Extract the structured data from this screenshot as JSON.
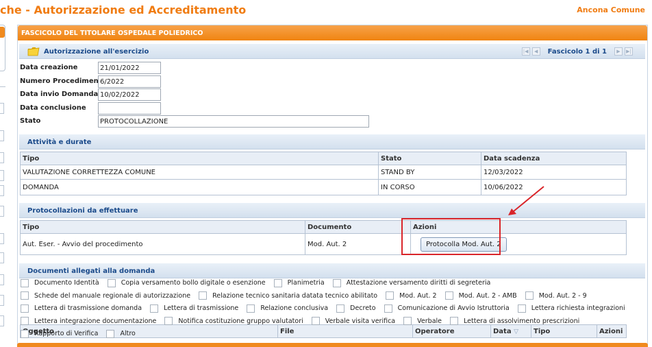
{
  "app": {
    "title": "che - Autorizzazione ed Accreditamento",
    "user": "Ancona Comune"
  },
  "panel": {
    "header": "FASCICOLO DEL TITOLARE OSPEDALE POLIEDRICO"
  },
  "authorization": {
    "title": "Autorizzazione all'esercizio",
    "pager_text": "Fascicolo 1 di 1",
    "fields": {
      "data_creazione": {
        "label": "Data creazione",
        "value": "21/01/2022"
      },
      "numero_procedimento": {
        "label": "Numero Procedimento",
        "value": "6/2022"
      },
      "data_invio_domanda": {
        "label": "Data invio Domanda",
        "value": "10/02/2022"
      },
      "data_conclusione": {
        "label": "Data conclusione",
        "value": ""
      },
      "stato": {
        "label": "Stato",
        "value": "PROTOCOLLAZIONE"
      }
    }
  },
  "activities": {
    "title": "Attività e durate",
    "columns": [
      "Tipo",
      "Stato",
      "Data scadenza"
    ],
    "rows": [
      [
        "VALUTAZIONE CORRETTEZZA COMUNE",
        "STAND BY",
        "12/03/2022"
      ],
      [
        "DOMANDA",
        "IN CORSO",
        "10/06/2022"
      ]
    ]
  },
  "protocols": {
    "title": "Protocollazioni da effettuare",
    "columns": [
      "Tipo",
      "Documento",
      "Azioni"
    ],
    "rows": [
      {
        "tipo": "Aut. Eser. - Avvio del procedimento",
        "documento": "Mod. Aut. 2",
        "action": "Protocolla Mod. Aut. 2"
      }
    ]
  },
  "documents": {
    "title": "Documenti allegati alla domanda",
    "filters": [
      "Documento Identità",
      "Copia versamento bollo digitale o esenzione",
      "Planimetria",
      "Attestazione versamento diritti di segreteria",
      "Schede del manuale regionale di autorizzazione",
      "Relazione tecnico sanitaria datata tecnico abilitato",
      "Mod. Aut. 2",
      "Mod. Aut. 2 - AMB",
      "Mod. Aut. 2 - 9",
      "Lettera di trasmissione domanda",
      "Lettera di trasmissione",
      "Relazione conclusiva",
      "Decreto",
      "Comunicazione di Avvio Istruttoria",
      "Lettera richiesta integrazioni",
      "Lettera integrazione documentazione",
      "Notifica costituzione gruppo valutatori",
      "Verbale visita verifica",
      "Verbale",
      "Lettera di assolvimento prescrizioni",
      "Rapporto di Verifica",
      "Altro"
    ],
    "columns": [
      "Oggetto",
      "File",
      "Operatore",
      "Data",
      "Tipo",
      "Azioni"
    ]
  },
  "colors": {
    "accent": "#f07c12",
    "header_text": "#1a4a8a",
    "highlight": "#d9252a"
  }
}
